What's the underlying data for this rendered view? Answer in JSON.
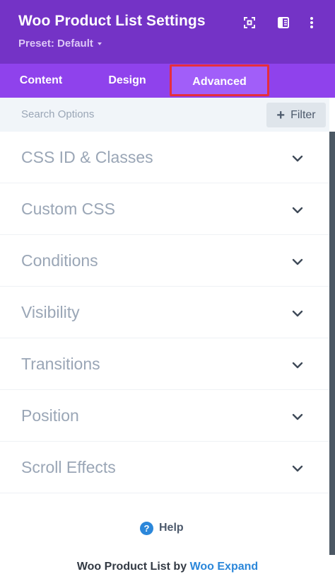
{
  "header": {
    "title": "Woo Product List Settings",
    "preset_label": "Preset: Default",
    "icons": [
      "expand-icon",
      "split-view-icon",
      "more-options-icon"
    ]
  },
  "tabs": [
    {
      "label": "Content",
      "active": false
    },
    {
      "label": "Design",
      "active": false
    },
    {
      "label": "Advanced",
      "active": true
    }
  ],
  "search": {
    "placeholder": "Search Options",
    "value": "",
    "filter_label": "Filter"
  },
  "sections": [
    {
      "label": "CSS ID & Classes"
    },
    {
      "label": "Custom CSS"
    },
    {
      "label": "Conditions"
    },
    {
      "label": "Visibility"
    },
    {
      "label": "Transitions"
    },
    {
      "label": "Position"
    },
    {
      "label": "Scroll Effects"
    }
  ],
  "help": {
    "label": "Help"
  },
  "footer": {
    "text": "Woo Product List by",
    "link": "Woo Expand"
  },
  "colors": {
    "header_bg": "#7433c6",
    "tabs_bg": "#8f42ec",
    "active_tab_bg": "#a15ef9",
    "highlight_border": "#e62e3c",
    "link": "#2b87da"
  }
}
